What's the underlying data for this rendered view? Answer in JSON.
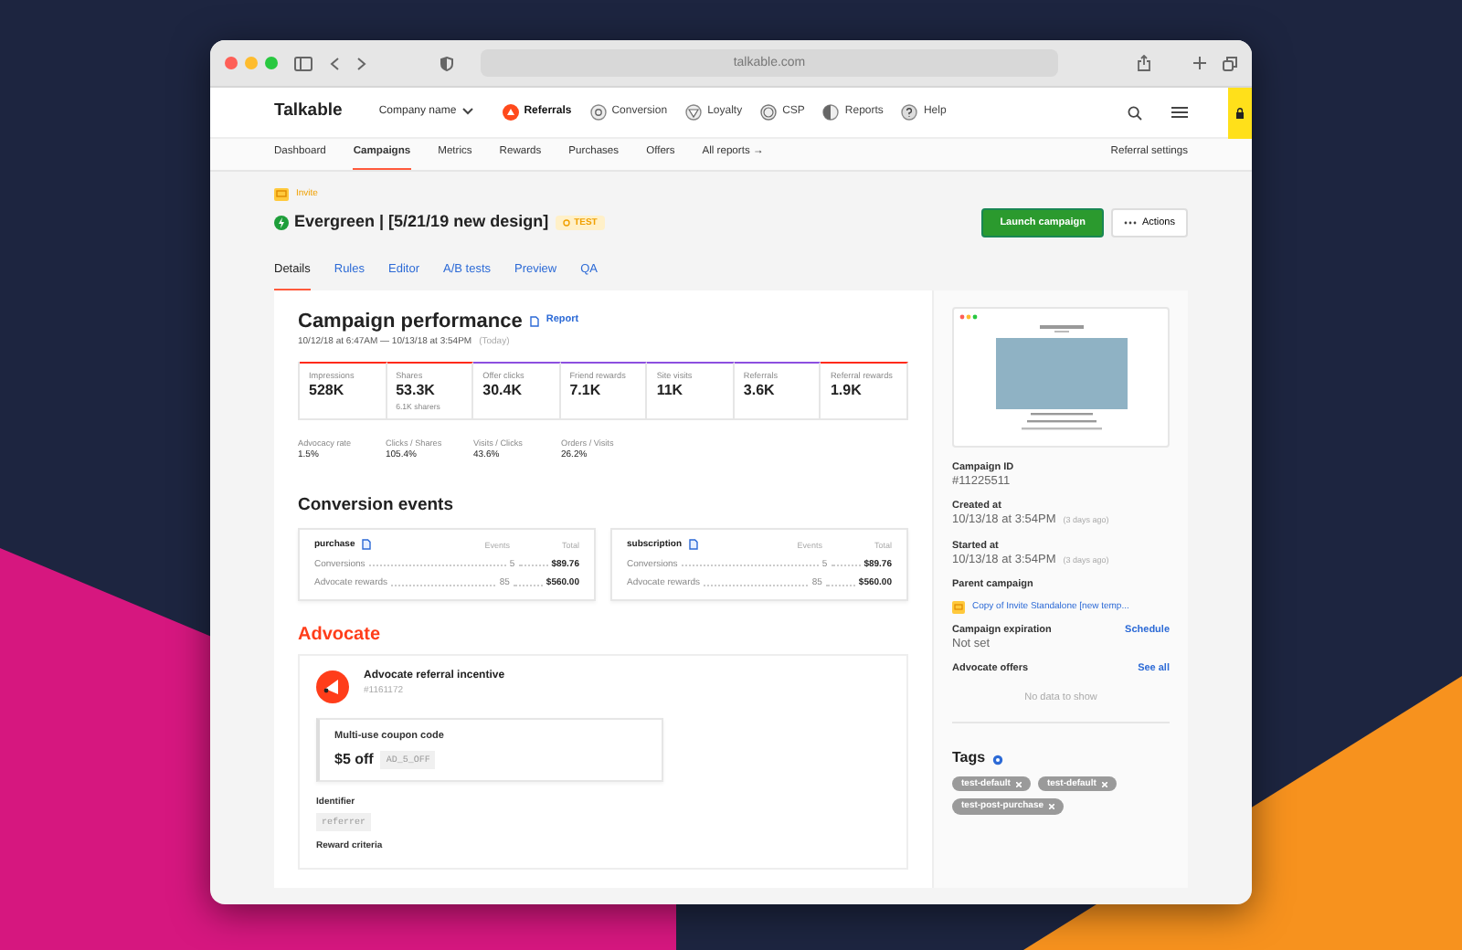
{
  "browser": {
    "url": "talkable.com"
  },
  "app_nav": {
    "logo": "Talkable",
    "company": "Company name",
    "items": [
      {
        "label": "Referrals",
        "selected": true
      },
      {
        "label": "Conversion",
        "selected": false
      },
      {
        "label": "Loyalty",
        "selected": false
      },
      {
        "label": "CSP",
        "selected": false
      },
      {
        "label": "Reports",
        "selected": false
      },
      {
        "label": "Help",
        "selected": false
      }
    ]
  },
  "subnav": {
    "items": [
      {
        "label": "Dashboard",
        "selected": false
      },
      {
        "label": "Campaigns",
        "selected": true
      },
      {
        "label": "Metrics",
        "selected": false
      },
      {
        "label": "Rewards",
        "selected": false
      },
      {
        "label": "Purchases",
        "selected": false
      },
      {
        "label": "Offers",
        "selected": false
      },
      {
        "label": "All reports →",
        "selected": false
      }
    ],
    "settings": "Referral settings"
  },
  "header": {
    "type_label": "Invite",
    "title": "Evergreen | [5/21/19 new design]",
    "badge": "TEST",
    "primary_button": "Launch campaign",
    "actions_button": "Actions"
  },
  "tabs": [
    {
      "label": "Details",
      "selected": true
    },
    {
      "label": "Rules",
      "selected": false
    },
    {
      "label": "Editor",
      "selected": false
    },
    {
      "label": "A/B tests",
      "selected": false
    },
    {
      "label": "Preview",
      "selected": false
    },
    {
      "label": "QA",
      "selected": false
    }
  ],
  "performance": {
    "title": "Campaign performance",
    "report_link": "Report",
    "date_range": "10/12/18 at 6:47AM — 10/13/18 at 3:54PM",
    "date_note": "(Today)",
    "metrics": [
      {
        "label": "Impressions",
        "value": "528K",
        "color": "#ff2a1a"
      },
      {
        "label": "Shares",
        "value": "53.3K",
        "sub": "6.1K sharers",
        "color": "#ff2a1a"
      },
      {
        "label": "Offer clicks",
        "value": "30.4K",
        "color": "#8c4fe0"
      },
      {
        "label": "Friend rewards",
        "value": "7.1K",
        "color": "#8c4fe0"
      },
      {
        "label": "Site visits",
        "value": "11K",
        "color": "#8c4fe0"
      },
      {
        "label": "Referrals",
        "value": "3.6K",
        "color": "#8c4fe0"
      },
      {
        "label": "Referral rewards",
        "value": "1.9K",
        "color": "#ff2a1a"
      }
    ],
    "ratios": [
      {
        "label": "Advocacy rate",
        "value": "1.5%"
      },
      {
        "label": "Clicks / Shares",
        "value": "105.4%"
      },
      {
        "label": "Visits / Clicks",
        "value": "43.6%"
      },
      {
        "label": "Orders / Visits",
        "value": "26.2%"
      }
    ]
  },
  "conversion": {
    "title": "Conversion events",
    "events": [
      {
        "name": "purchase",
        "col_events": "Events",
        "col_total": "Total",
        "rows": [
          {
            "label": "Conversions",
            "events": "5",
            "total": "$89.76"
          },
          {
            "label": "Advocate rewards",
            "events": "85",
            "total": "$560.00"
          }
        ]
      },
      {
        "name": "subscription",
        "col_events": "Events",
        "col_total": "Total",
        "rows": [
          {
            "label": "Conversions",
            "events": "5",
            "total": "$89.76"
          },
          {
            "label": "Advocate rewards",
            "events": "85",
            "total": "$560.00"
          }
        ]
      }
    ]
  },
  "advocate": {
    "title": "Advocate",
    "incentive_title": "Advocate referral incentive",
    "incentive_id": "#1161172",
    "coupon_label": "Multi-use coupon code",
    "coupon_amount": "$5 off",
    "coupon_code": "AD_5_OFF",
    "identifier_label": "Identifier",
    "identifier": "referrer",
    "criteria_label": "Reward criteria"
  },
  "sidebar": {
    "campaign_id_label": "Campaign ID",
    "campaign_id": "#11225511",
    "created_label": "Created at",
    "created": "10/13/18 at 3:54PM",
    "created_note": "(3 days ago)",
    "started_label": "Started at",
    "started": "10/13/18 at 3:54PM",
    "started_note": "(3 days ago)",
    "parent_label": "Parent campaign",
    "parent_link": "Copy of Invite Standalone [new temp...",
    "expiration_label": "Campaign expiration",
    "schedule_link": "Schedule",
    "expiration": "Not set",
    "offers_label": "Advocate offers",
    "see_all_link": "See all",
    "offers_empty": "No data to show",
    "tags_title": "Tags",
    "tags": [
      "test-default",
      "test-default",
      "test-post-purchase"
    ]
  }
}
